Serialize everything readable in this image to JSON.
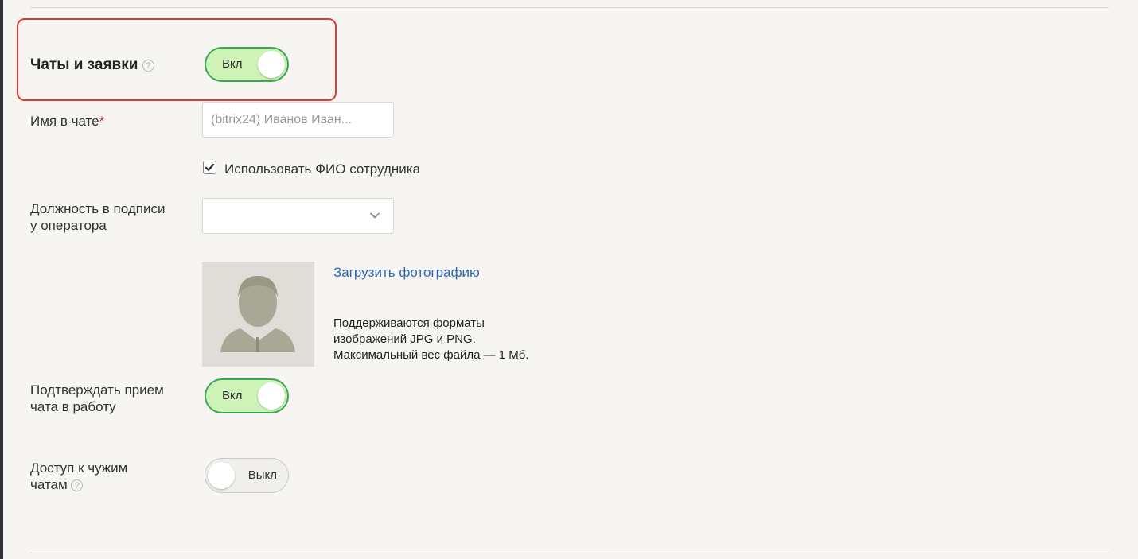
{
  "chats": {
    "label": "Чаты и заявки",
    "help": "?",
    "toggle_label": "Вкл"
  },
  "chat_name": {
    "label": "Имя в чате",
    "required_mark": "*",
    "value": "(bitrix24) Иванов Иван..."
  },
  "use_fio": {
    "label": "Использовать ФИО сотрудника",
    "checked": true
  },
  "position": {
    "label_line1": "Должность в подписи",
    "label_line2": "у оператора",
    "value": ""
  },
  "photo": {
    "upload_link": "Загрузить фотографию",
    "note_line1": "Поддерживаются форматы",
    "note_line2": "изображений JPG и PNG.",
    "note_line3": "Максимальный вес файла — 1 Мб."
  },
  "confirm_chat": {
    "label_line1": "Подтверждать прием",
    "label_line2": "чата в работу",
    "toggle_label": "Вкл"
  },
  "foreign_chats": {
    "label_line1": "Доступ к чужим",
    "label_line2": "чатам",
    "help": "?",
    "toggle_label": "Выкл"
  },
  "colors": {
    "toggle_on_bg": "#cdf3b6",
    "toggle_on_border": "#3aa757",
    "highlight": "#e33b2e",
    "link": "#2f67b5",
    "required": "#c62828"
  },
  "icons": {
    "avatar": "person-silhouette-icon",
    "dropdown": "chevron-down-icon",
    "check": "checkmark-icon",
    "help": "question-circle-icon"
  }
}
